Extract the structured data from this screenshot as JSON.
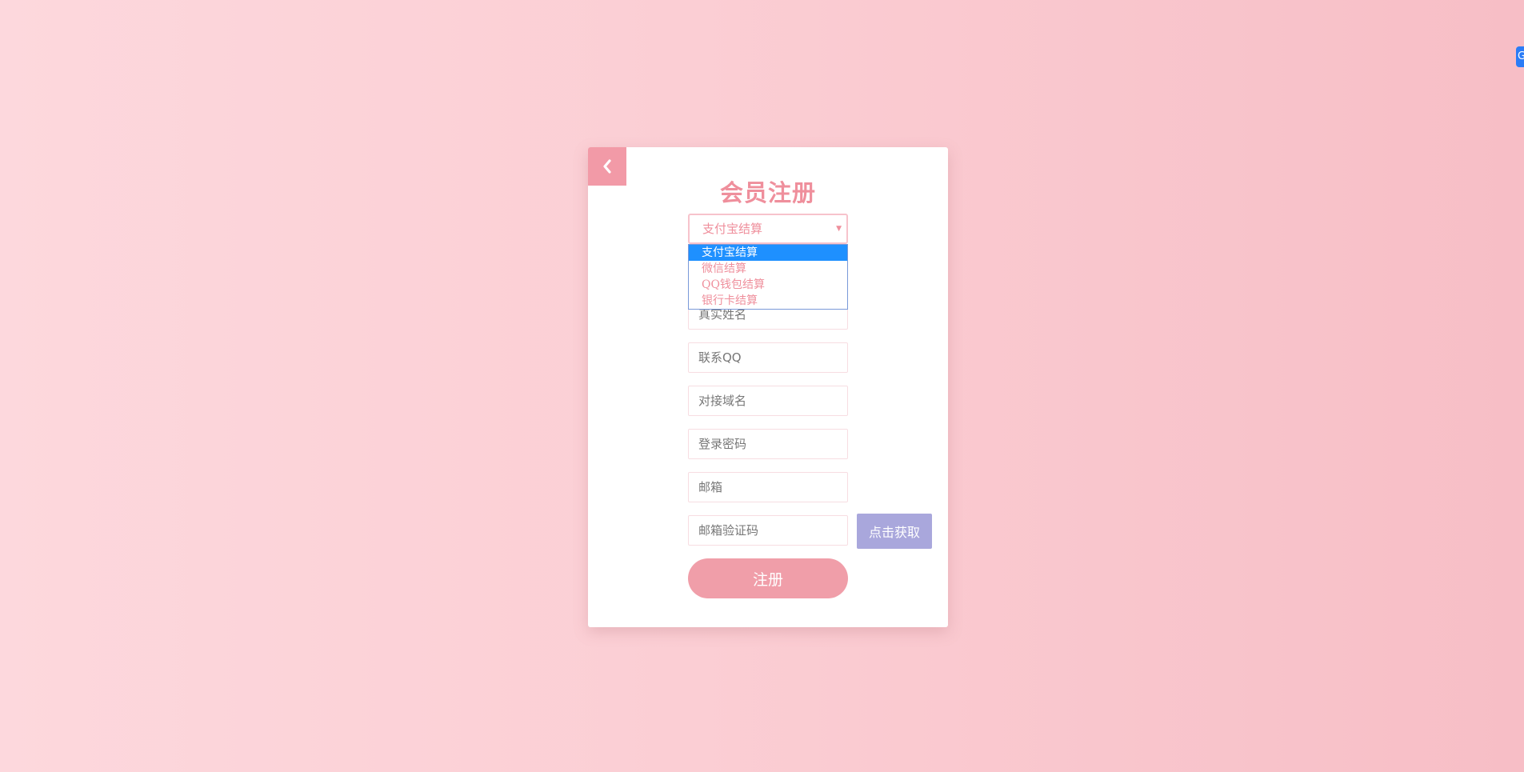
{
  "form": {
    "title": "会员注册",
    "settlement": {
      "selected": "支付宝结算",
      "options": [
        "支付宝结算",
        "微信结算",
        "QQ钱包结算",
        "银行卡结算"
      ]
    },
    "fields": {
      "real_name_placeholder": "真实姓名",
      "qq_placeholder": "联系QQ",
      "domain_placeholder": "对接域名",
      "password_placeholder": "登录密码",
      "email_placeholder": "邮箱",
      "email_code_placeholder": "邮箱验证码"
    },
    "get_code_label": "点击获取",
    "register_label": "注册"
  },
  "side_tab": {
    "label": "G"
  },
  "colors": {
    "accent_pink": "#ef8f9c",
    "button_pink": "#f09ea9",
    "back_button": "#f29aa7",
    "code_button": "#a9a7dc",
    "dropdown_highlight": "#1e90ff"
  }
}
